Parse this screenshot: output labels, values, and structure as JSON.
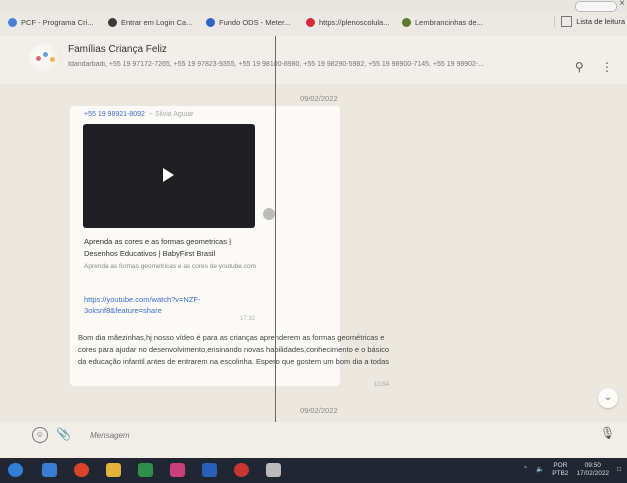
{
  "browser": {
    "bookmarks": [
      {
        "label": "PCF - Programa Cri...",
        "color": "#4a7fd8"
      },
      {
        "label": "Entrar em Login Ca...",
        "color": "#3a3a3a"
      },
      {
        "label": "Fundo ODS - Meter...",
        "color": "#2a66c4"
      },
      {
        "label": "https://plenoscolula...",
        "color": "#d62c3a"
      },
      {
        "label": "Lembrancinhas de...",
        "color": "#5b7a2a"
      }
    ],
    "reading_list": "Lista de leitura"
  },
  "chat": {
    "group_name": "Famílias Criança Feliz",
    "members": "Idandarbadi, +55 19 97172-7265, +55 19 97823-9355, +55 19 98100-8980, +55 19 98290-5982, +55 19 98900-7145, +55 19 98902-...",
    "date_top": "09/02/2022",
    "message": {
      "sender": "+55 19 98921-8092",
      "sender_alias": "~ Silvia Aguiar",
      "link_title": "Aprenda as cores e as formas geometricas | Desenhos Educativos | BabyFirst Brasil",
      "link_desc": "Aprenda as formas geometricas e as cores de youtube.com",
      "url": "https://youtube.com/watch?v=NZF-3oksnf8&feature=share",
      "time1": "17:32",
      "text": "Bom dia mãezinhas,hj nosso vídeo é para as crianças aprenderem as formas geométricas e cores para ajudar no desenvolvimento,ensinando novas habilidades,conhecimento e o básico da educação infantil antes de entrarem na escolinha. Espero que gostem um bom dia a todas",
      "time2": "10:54"
    },
    "date_bottom": "09/02/2022",
    "input_placeholder": "Mensagem"
  },
  "taskbar": {
    "apps": [
      "#2f7fd8",
      "#3b7bd4",
      "#d8432a",
      "#e2b33a",
      "#2f8f4a",
      "#c9417a",
      "#2a5fb8",
      "#c8362f",
      "#bbbbbb"
    ],
    "lang": "POR",
    "lang2": "PTB2",
    "time": "09:50",
    "date": "17/02/2022"
  }
}
